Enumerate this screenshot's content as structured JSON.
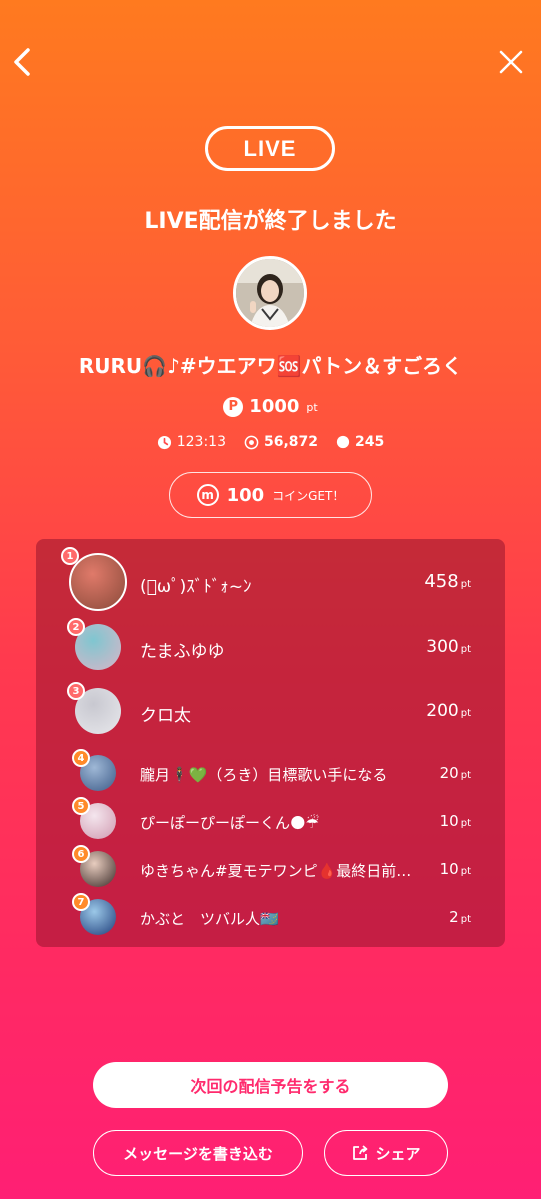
{
  "header": {
    "live_badge": "LIVE",
    "ended_title": "LIVE配信が終了しました"
  },
  "streamer": {
    "name": "RURU🎧♪#ウエアワ🆘パトン＆すごろく",
    "points_badge": "P",
    "points": "1000",
    "points_unit": "pt"
  },
  "stats": {
    "duration": "123:13",
    "views": "56,872",
    "comments": "245"
  },
  "coin": {
    "icon_letter": "m",
    "amount": "100",
    "label": "コインGET！"
  },
  "ranking": [
    {
      "rank": "1",
      "name": "(ﾟωﾟ)ｽﾞﾄﾞｫ~ﾝ",
      "display": "(ᐛ˘ᗜ˘ᐛ)ｽﾞﾄﾞｫ~ﾝ",
      "points": "458",
      "unit": "pt",
      "rank_color": "#ff6a6a"
    },
    {
      "rank": "2",
      "name": "たまふゆゆ",
      "points": "300",
      "unit": "pt",
      "rank_color": "#ff6a6a"
    },
    {
      "rank": "3",
      "name": "クロ太",
      "points": "200",
      "unit": "pt",
      "rank_color": "#ff6a6a"
    },
    {
      "rank": "4",
      "name": "朧月🕴💚（ろき）目標歌い手になる",
      "points": "20",
      "unit": "pt",
      "rank_color": "#ff8a2a"
    },
    {
      "rank": "5",
      "name": "ぴーぽーぴーぽーくん🌑☔",
      "points": "10",
      "unit": "pt",
      "rank_color": "#ff8a2a"
    },
    {
      "rank": "6",
      "name": "ゆきちゃん#夏モテワンピ🩸最終日前…",
      "points": "10",
      "unit": "pt",
      "rank_color": "#ff8a2a"
    },
    {
      "rank": "7",
      "name": "かぶと　ツバル人🇹🇻",
      "points": "2",
      "unit": "pt",
      "rank_color": "#ff8a2a"
    }
  ],
  "actions": {
    "announce": "次回の配信予告をする",
    "message": "メッセージを書き込む",
    "share": "シェア"
  }
}
